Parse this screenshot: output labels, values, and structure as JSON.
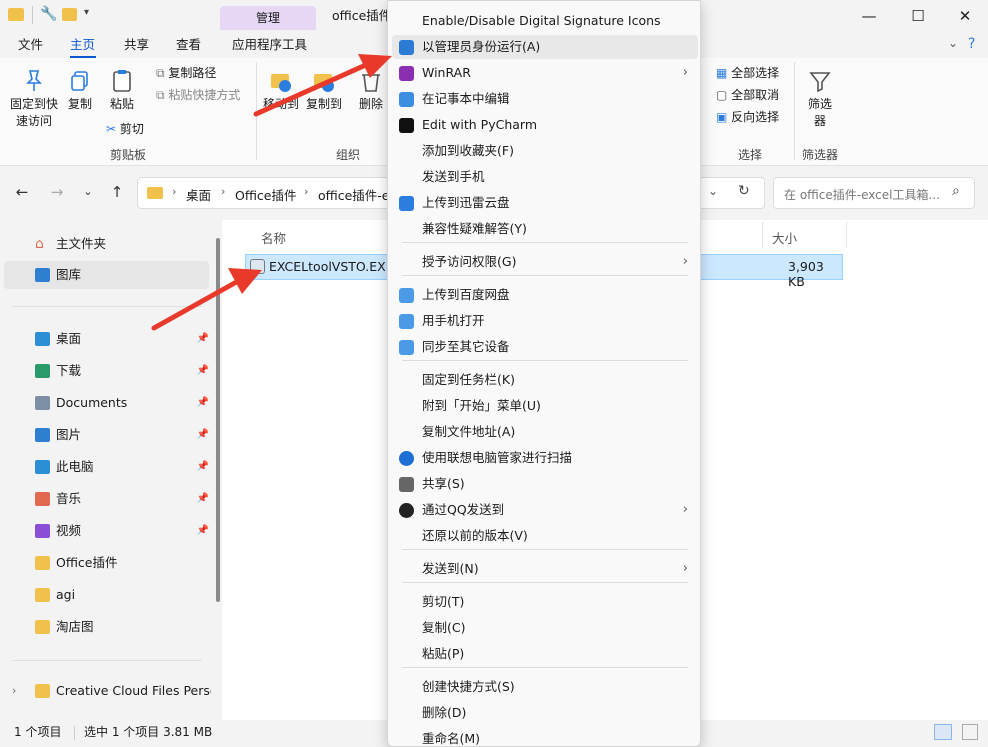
{
  "titlebar": {
    "context_tab": "管理",
    "title": "office插件",
    "minimize": "—",
    "maximize": "☐",
    "close": "✕"
  },
  "tabs": [
    "文件",
    "主页",
    "共享",
    "查看",
    "应用程序工具"
  ],
  "ribbon": {
    "pin_quick": "固定到快\n速访问",
    "copy": "复制",
    "paste": "粘贴",
    "copy_path": "复制路径",
    "paste_shortcut": "粘贴快捷方式",
    "cut": "剪切",
    "clipboard_group": "剪贴板",
    "move_to": "移动到",
    "copy_to": "复制到",
    "delete": "删除",
    "organize_group": "组织",
    "select_all": "全部选择",
    "select_none": "全部取消",
    "invert_selection": "反向选择",
    "select_group": "选择",
    "filter": "筛选\n器",
    "filter_group": "筛选器"
  },
  "address": {
    "crumbs": [
      "桌面",
      "Office插件",
      "office插件-e"
    ],
    "search_placeholder": "在 office插件-excel工具箱..."
  },
  "navpane": {
    "home": "主文件夹",
    "gallery": "图库",
    "quick": [
      {
        "label": "桌面",
        "color": "#2b8fd6"
      },
      {
        "label": "下载",
        "color": "#2a9a6a"
      },
      {
        "label": "Documents",
        "color": "#7c8fa5"
      },
      {
        "label": "图片",
        "color": "#2f7fd1"
      },
      {
        "label": "此电脑",
        "color": "#2b8fd6"
      },
      {
        "label": "音乐",
        "color": "#e0694f"
      },
      {
        "label": "视频",
        "color": "#8a4fd6"
      },
      {
        "label": "Office插件",
        "color": "#f0c24c"
      },
      {
        "label": "agi",
        "color": "#f0c24c"
      },
      {
        "label": "淘店图",
        "color": "#f0c24c"
      }
    ],
    "creative_cloud": "Creative Cloud Files Person"
  },
  "files": {
    "col_name": "名称",
    "col_size": "大小",
    "rows": [
      {
        "name": "EXCELtoolVSTO.EXE",
        "size": "3,903 KB"
      }
    ]
  },
  "status": {
    "count": "1 个项目",
    "selected": "选中 1 个项目 3.81 MB"
  },
  "context_menu": {
    "items": [
      {
        "label": "Enable/Disable Digital Signature Icons",
        "icon": "none",
        "arrow": false
      },
      {
        "label": "以管理员身份运行(A)",
        "icon": "shield-icon",
        "arrow": false,
        "hover": true
      },
      {
        "label": "WinRAR",
        "icon": "winrar-icon",
        "arrow": true
      },
      {
        "label": "在记事本中编辑",
        "icon": "notepad-icon",
        "arrow": false
      },
      {
        "label": "Edit with PyCharm",
        "icon": "pycharm-icon",
        "arrow": false
      },
      {
        "label": "添加到收藏夹(F)",
        "icon": "none",
        "arrow": false
      },
      {
        "label": "发送到手机",
        "icon": "none",
        "arrow": false
      },
      {
        "label": "上传到迅雷云盘",
        "icon": "thunder-icon",
        "arrow": false
      },
      {
        "label": "兼容性疑难解答(Y)",
        "icon": "none",
        "arrow": false
      },
      {
        "label": "授予访问权限(G)",
        "icon": "none",
        "arrow": true
      },
      {
        "label": "上传到百度网盘",
        "icon": "baidu-icon",
        "arrow": false
      },
      {
        "label": "用手机打开",
        "icon": "baidu-icon",
        "arrow": false
      },
      {
        "label": "同步至其它设备",
        "icon": "baidu-icon",
        "arrow": false
      },
      {
        "label": "固定到任务栏(K)",
        "icon": "none",
        "arrow": false
      },
      {
        "label": "附到「开始」菜单(U)",
        "icon": "none",
        "arrow": false
      },
      {
        "label": "复制文件地址(A)",
        "icon": "none",
        "arrow": false
      },
      {
        "label": "使用联想电脑管家进行扫描",
        "icon": "lenovo-icon",
        "arrow": false
      },
      {
        "label": "共享(S)",
        "icon": "share-icon",
        "arrow": false
      },
      {
        "label": "通过QQ发送到",
        "icon": "qq-icon",
        "arrow": true
      },
      {
        "label": "还原以前的版本(V)",
        "icon": "none",
        "arrow": false
      },
      {
        "label": "发送到(N)",
        "icon": "none",
        "arrow": true
      },
      {
        "label": "剪切(T)",
        "icon": "none",
        "arrow": false
      },
      {
        "label": "复制(C)",
        "icon": "none",
        "arrow": false
      },
      {
        "label": "粘贴(P)",
        "icon": "none",
        "arrow": false
      },
      {
        "label": "创建快捷方式(S)",
        "icon": "none",
        "arrow": false
      },
      {
        "label": "删除(D)",
        "icon": "none",
        "arrow": false
      },
      {
        "label": "重命名(M)",
        "icon": "none",
        "arrow": false
      }
    ]
  },
  "colors": {
    "accent": "#0b57d0",
    "selection": "#cce8ff",
    "annotation_arrow": "#e8392b"
  }
}
